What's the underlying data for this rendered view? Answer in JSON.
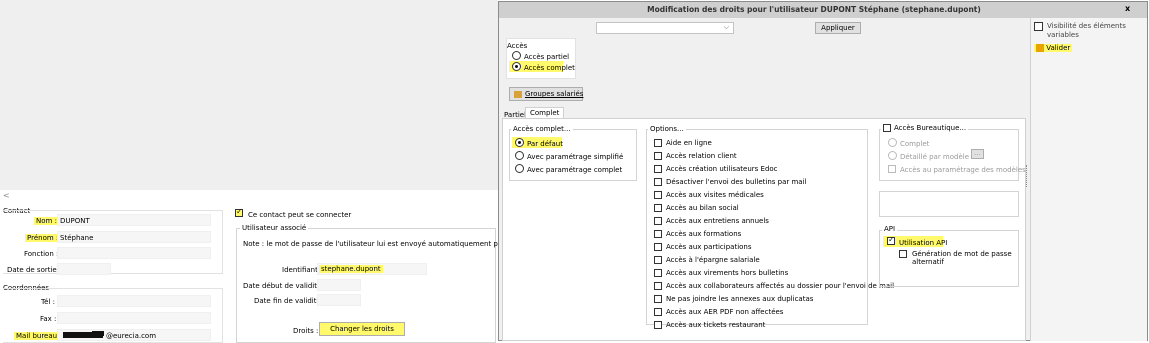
{
  "left": {
    "scroll_arrow": "<",
    "contact": {
      "section_title": "Contact",
      "nom_label": "Nom :",
      "nom_value": "DUPONT",
      "prenom_label": "Prénom :",
      "prenom_value": "Stéphane",
      "fonction_label": "Fonction :",
      "date_sortie_label": "Date de sortie :"
    },
    "coordonnees": {
      "section_title": "Coordonnées",
      "tel_label": "Tél :",
      "fax_label": "Fax :",
      "mail_label": "Mail bureau :",
      "mail_suffix": "@eurecia.com"
    },
    "connect_checkbox_label": "Ce contact peut se connecter",
    "user": {
      "group_title": "Utilisateur associé",
      "note": "Note : le mot de passe de l'utilisateur lui est envoyé automatiquement par mail.",
      "identifiant_label": "Identifiant :",
      "identifiant_value": "stephane.dupont",
      "date_debut_label": "Date début de validité :",
      "date_fin_label": "Date fin de validité :",
      "droits_label": "Droits :",
      "change_rights_button": "Changer les droits"
    }
  },
  "dialog": {
    "title": "Modification des droits pour l'utilisateur DUPONT Stéphane (stephane.dupont)",
    "close_label": "x",
    "apply_button": "Appliquer",
    "acces": {
      "title": "Accès",
      "partiel": "Accès partiel",
      "complet": "Accès complet"
    },
    "groupes_button": "Groupes salariés",
    "tabs": [
      "Partiel",
      "Complet"
    ],
    "acces_complet": {
      "title": "Accès complet...",
      "options": [
        "Par défaut",
        "Avec paramétrage simplifié",
        "Avec paramétrage complet"
      ]
    },
    "options": {
      "title": "Options...",
      "items": [
        "Aide en ligne",
        "Accès relation client",
        "Accès création utilisateurs Edoc",
        "Désactiver l'envoi des bulletins par mail",
        "Accès aux visites médicales",
        "Accès au bilan social",
        "Accès aux entretiens annuels",
        "Accès aux formations",
        "Accès aux participations",
        "Accès à l'épargne salariale",
        "Accès aux virements hors bulletins",
        "Accès aux collaborateurs affectés au dossier pour l'envoi de mail",
        "Ne pas joindre les annexes aux duplicatas",
        "Accès aux AER PDF non affectées",
        "Accès aux tickets restaurant"
      ]
    },
    "bureautique": {
      "title": "Accès Bureautique...",
      "complet": "Complet",
      "detaille": "Détaillé par modèle :",
      "detaille_button": "...",
      "parametrage": "Accès au paramétrage des modèles"
    },
    "api": {
      "title": "API",
      "utilisation": "Utilisation API",
      "generation_line1": "Génération de mot de passe",
      "generation_line2": "alternatif"
    },
    "side": {
      "visibility": "Visibilité des éléments variables",
      "valider": "Valider"
    }
  },
  "colors": {
    "highlight": "#fff96b",
    "titlebar": "#cfcfcf",
    "window_bg": "#f0f0f0"
  }
}
